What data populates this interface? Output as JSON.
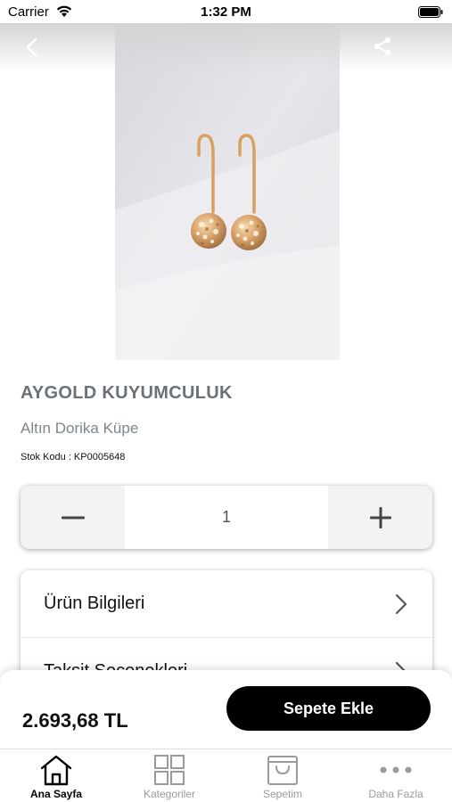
{
  "status_bar": {
    "carrier": "Carrier",
    "time": "1:32 PM"
  },
  "product": {
    "brand": "AYGOLD KUYUMCULUK",
    "name": "Altın Dorika Küpe",
    "stock_code": "Stok Kodu : KP0005648",
    "quantity": "1",
    "price": "2.693,68 TL"
  },
  "info_sections": [
    {
      "label": "Ürün Bilgileri"
    },
    {
      "label": "Taksit Seçenekleri"
    }
  ],
  "actions": {
    "add_to_cart": "Sepete Ekle"
  },
  "tab_bar": [
    {
      "label": "Ana Sayfa",
      "icon": "home-icon",
      "active": true
    },
    {
      "label": "Kategoriler",
      "icon": "grid-icon",
      "active": false
    },
    {
      "label": "Sepetim",
      "icon": "bag-icon",
      "active": false
    },
    {
      "label": "Daha Fazla",
      "icon": "more-icon",
      "active": false
    }
  ],
  "colors": {
    "accent": "#000000",
    "brand_text": "#6b7277",
    "muted_tab": "#9a9a9a"
  }
}
